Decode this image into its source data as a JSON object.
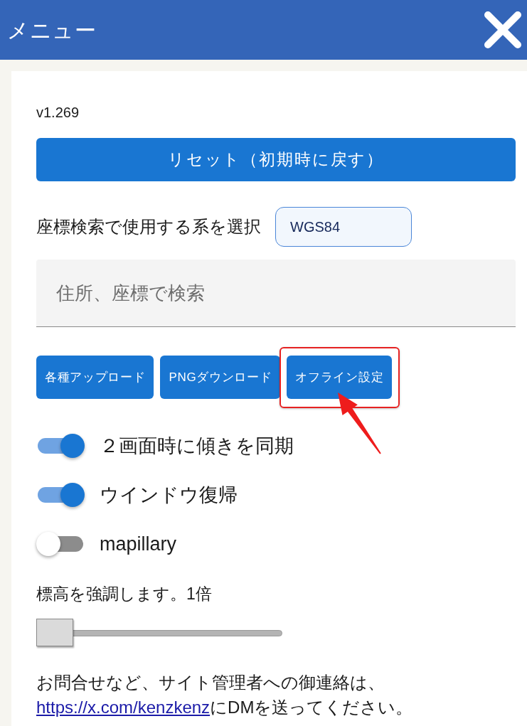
{
  "header": {
    "title": "メニュー"
  },
  "version": "v1.269",
  "reset_button": "リセット（初期時に戻す）",
  "coordinate_system": {
    "label": "座標検索で使用する系を選択",
    "value": "WGS84"
  },
  "search": {
    "placeholder": "住所、座標で検索"
  },
  "action_buttons": [
    {
      "label": "各種アップロード",
      "highlighted": false
    },
    {
      "label": "PNGダウンロード",
      "highlighted": false
    },
    {
      "label": "オフライン設定",
      "highlighted": true
    }
  ],
  "toggles": [
    {
      "label": "２画面時に傾きを同期",
      "on": true
    },
    {
      "label": "ウインドウ復帰",
      "on": true
    },
    {
      "label": "mapillary",
      "on": false
    }
  ],
  "elevation": {
    "label": "標高を強調します。1倍",
    "level": 0
  },
  "contact": {
    "text_before": "お問合せなど、サイト管理者への御連絡は、",
    "link": "https://x.com/kenzkenz",
    "text_after": "にDMを送ってください。"
  }
}
